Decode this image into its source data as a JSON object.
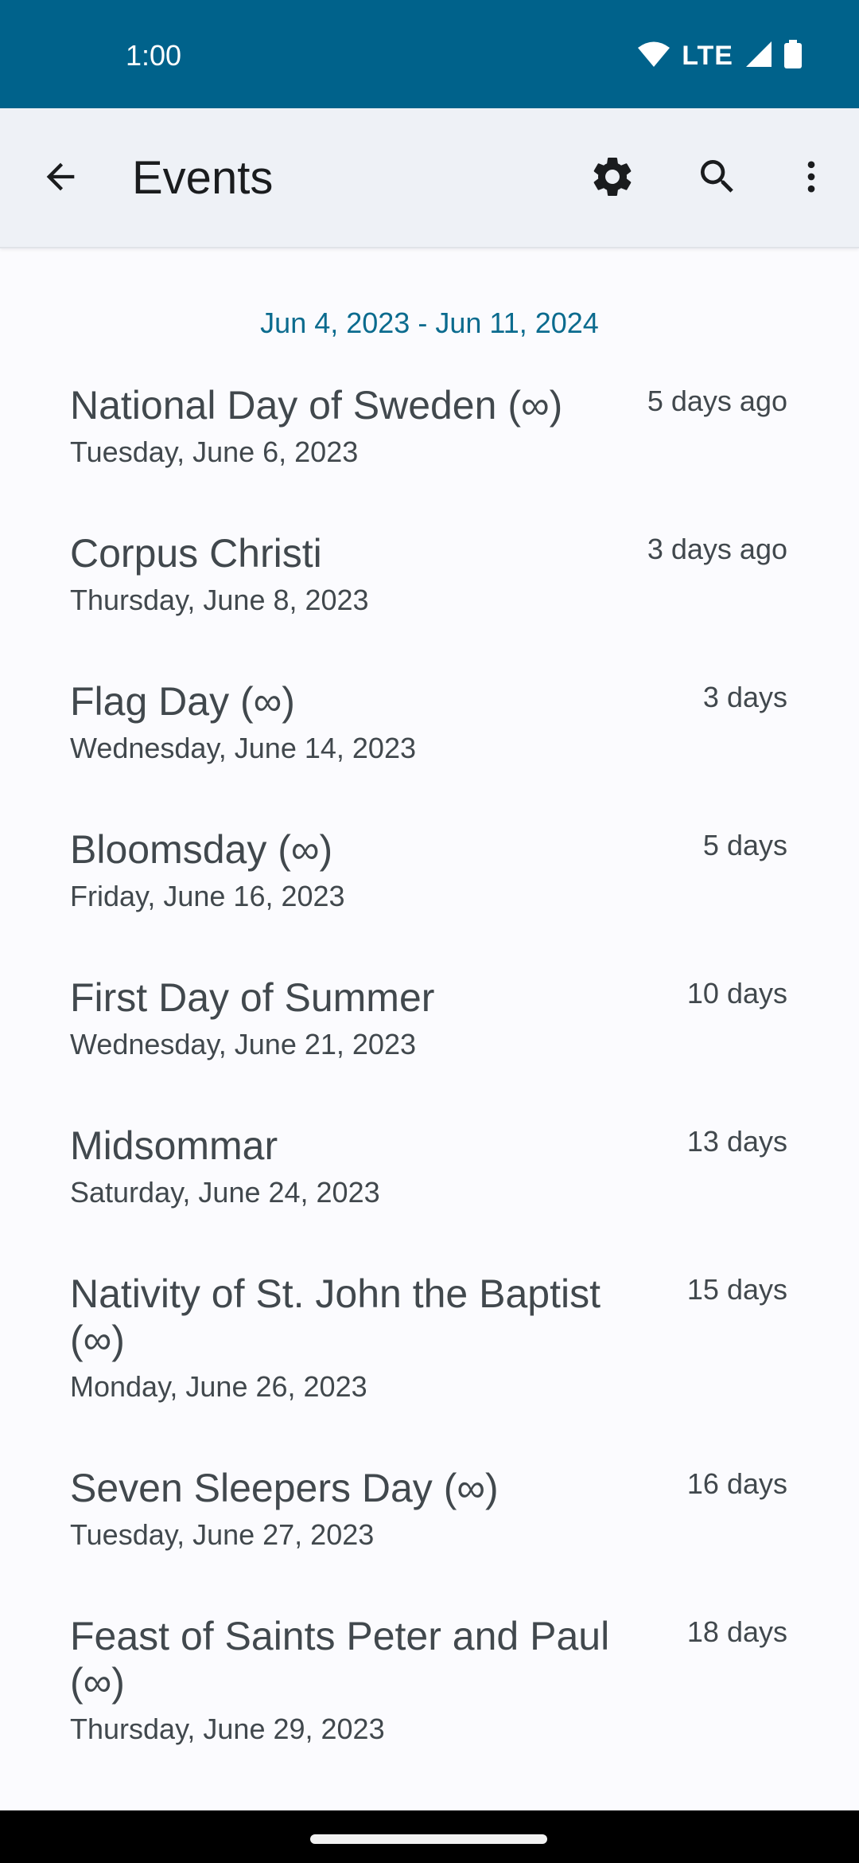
{
  "status_bar": {
    "time": "1:00",
    "network": "LTE"
  },
  "app_bar": {
    "title": "Events"
  },
  "range_label": "Jun 4, 2023 - Jun 11, 2024",
  "events": [
    {
      "title": "National Day of Sweden (∞)",
      "date": "Tuesday, June 6, 2023",
      "relative": "5 days ago"
    },
    {
      "title": "Corpus Christi",
      "date": "Thursday, June 8, 2023",
      "relative": "3 days ago"
    },
    {
      "title": "Flag Day (∞)",
      "date": "Wednesday, June 14, 2023",
      "relative": "3 days"
    },
    {
      "title": "Bloomsday (∞)",
      "date": "Friday, June 16, 2023",
      "relative": "5 days"
    },
    {
      "title": "First Day of Summer",
      "date": "Wednesday, June 21, 2023",
      "relative": "10 days"
    },
    {
      "title": "Midsommar",
      "date": "Saturday, June 24, 2023",
      "relative": "13 days"
    },
    {
      "title": "Nativity of St. John the Baptist (∞)",
      "date": "Monday, June 26, 2023",
      "relative": "15 days"
    },
    {
      "title": "Seven Sleepers Day (∞)",
      "date": "Tuesday, June 27, 2023",
      "relative": "16 days"
    },
    {
      "title": "Feast of Saints Peter and Paul (∞)",
      "date": "Thursday, June 29, 2023",
      "relative": "18 days"
    }
  ],
  "icons": {
    "back": "arrow-back-icon",
    "settings": "gear-icon",
    "search": "search-icon",
    "more": "more-vert-icon",
    "wifi": "wifi-icon",
    "signal": "signal-icon",
    "battery": "battery-icon"
  },
  "colors": {
    "status_bar": "#00628b",
    "app_bar": "#eef1f6",
    "accent_text": "#0b6b8e",
    "body_text": "#41484d"
  }
}
